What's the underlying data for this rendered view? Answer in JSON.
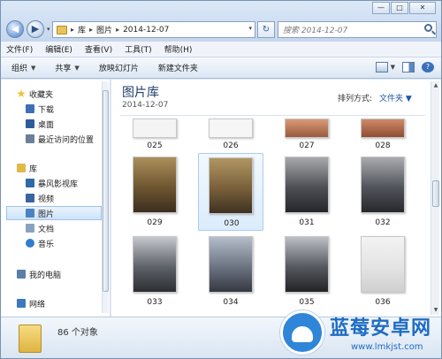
{
  "window": {
    "controls": {
      "minimize": "—",
      "maximize": "□",
      "close": "✕"
    }
  },
  "address": {
    "back_glyph": "◀",
    "forward_glyph": "▶",
    "crumbs": [
      "库",
      "图片",
      "2014-12-07"
    ],
    "separator": "▸",
    "dropdown_glyph": "▾",
    "refresh_glyph": "↻",
    "search_placeholder": "搜索 2014-12-07"
  },
  "menu": [
    "文件(F)",
    "编辑(E)",
    "查看(V)",
    "工具(T)",
    "帮助(H)"
  ],
  "toolbar": {
    "organize": "组织",
    "share": "共享",
    "slideshow": "放映幻灯片",
    "new_folder": "新建文件夹",
    "caret": "▼",
    "help": "?"
  },
  "sidebar": {
    "items": [
      {
        "label": "收藏夹",
        "icon": "star-icon",
        "color": "#f2c12e"
      },
      {
        "label": "下载",
        "icon": "download-folder-icon",
        "color": "#3f6fb6"
      },
      {
        "label": "桌面",
        "icon": "desktop-icon",
        "color": "#2d5c9a"
      },
      {
        "label": "最近访问的位置",
        "icon": "recent-places-icon",
        "color": "#6b7f99"
      },
      {
        "label": "库",
        "icon": "library-icon",
        "color": "#e2b849"
      },
      {
        "label": "暴风影视库",
        "icon": "video-library-icon",
        "color": "#2f6aa8"
      },
      {
        "label": "视频",
        "icon": "video-icon",
        "color": "#3a63a0"
      },
      {
        "label": "图片",
        "icon": "pictures-icon",
        "color": "#4a82c4"
      },
      {
        "label": "文档",
        "icon": "documents-icon",
        "color": "#8aa2c2"
      },
      {
        "label": "音乐",
        "icon": "music-icon",
        "color": "#2f7fd0"
      },
      {
        "label": "我的电脑",
        "icon": "computer-icon",
        "color": "#5a7fa8"
      },
      {
        "label": "网络",
        "icon": "network-icon",
        "color": "#3e78bd"
      }
    ]
  },
  "content": {
    "title": "图片库",
    "subtitle": "2014-12-07",
    "arrange_label": "排列方式:",
    "arrange_value": "文件夹 ▼",
    "thumbnails": [
      {
        "caption": "025",
        "tone": "#f4f4f4"
      },
      {
        "caption": "026",
        "tone": "#f6f6f6"
      },
      {
        "caption": "027",
        "tone": "#c9896a"
      },
      {
        "caption": "028",
        "tone": "#c07a5c"
      },
      {
        "caption": "029",
        "tone": "#8a6a3e"
      },
      {
        "caption": "030",
        "tone": "#8f7140"
      },
      {
        "caption": "031",
        "tone": "#6c6f73"
      },
      {
        "caption": "032",
        "tone": "#71757b"
      },
      {
        "caption": "033",
        "tone": "#7a7f86"
      },
      {
        "caption": "034",
        "tone": "#8a8f98"
      },
      {
        "caption": "035",
        "tone": "#6d7077"
      },
      {
        "caption": "036",
        "tone": "#e8e8e8"
      }
    ]
  },
  "status": {
    "count_text": "86 个对象"
  },
  "watermark": {
    "brand": "蓝莓安卓网",
    "url": "www.lmkjst.com"
  }
}
